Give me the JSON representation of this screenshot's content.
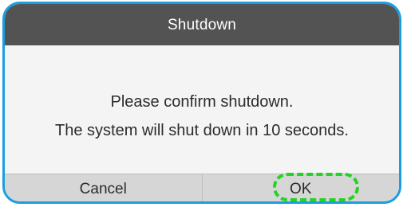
{
  "dialog": {
    "title": "Shutdown",
    "message_line1": "Please confirm shutdown.",
    "message_line2": "The system will shut down in 10 seconds.",
    "buttons": {
      "cancel_label": "Cancel",
      "ok_label": "OK"
    }
  },
  "colors": {
    "border_accent": "#1a9ee0",
    "titlebar": "#535353",
    "highlight": "#22d422"
  }
}
